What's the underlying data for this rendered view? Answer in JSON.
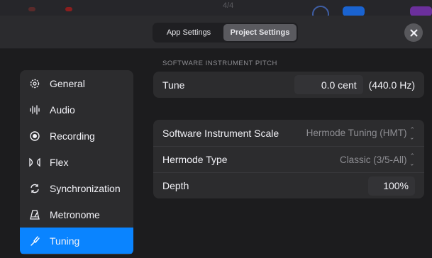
{
  "host": {
    "time_signature": "4/4"
  },
  "header": {
    "tabs": [
      {
        "label": "App Settings",
        "selected": false
      },
      {
        "label": "Project Settings",
        "selected": true
      }
    ],
    "close_icon": "close-icon"
  },
  "sidebar": {
    "items": [
      {
        "label": "General",
        "icon": "gear-icon",
        "selected": false
      },
      {
        "label": "Audio",
        "icon": "waveform-icon",
        "selected": false
      },
      {
        "label": "Recording",
        "icon": "record-icon",
        "selected": false
      },
      {
        "label": "Flex",
        "icon": "flex-icon",
        "selected": false
      },
      {
        "label": "Synchronization",
        "icon": "sync-icon",
        "selected": false
      },
      {
        "label": "Metronome",
        "icon": "metronome-icon",
        "selected": false
      },
      {
        "label": "Tuning",
        "icon": "tuning-fork-icon",
        "selected": true
      }
    ]
  },
  "main": {
    "section_title": "SOFTWARE INSTRUMENT PITCH",
    "tune": {
      "label": "Tune",
      "value": "0.0 cent",
      "hz": "(440.0 Hz)"
    },
    "scale": {
      "label": "Software Instrument Scale",
      "value": "Hermode Tuning (HMT)"
    },
    "hermode_type": {
      "label": "Hermode Type",
      "value": "Classic (3/5-All)"
    },
    "depth": {
      "label": "Depth",
      "value": "100%"
    }
  },
  "colors": {
    "accent": "#0a84ff",
    "background": "#1c1c1e",
    "panel": "#2c2c2e"
  }
}
